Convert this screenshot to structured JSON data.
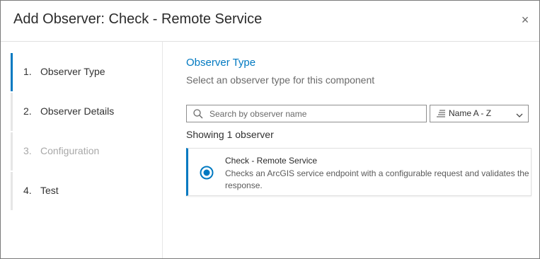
{
  "dialog": {
    "title": "Add Observer: Check - Remote Service",
    "close_glyph": "×"
  },
  "steps": [
    {
      "number": "1.",
      "label": "Observer Type",
      "state": "active"
    },
    {
      "number": "2.",
      "label": "Observer Details",
      "state": "enabled"
    },
    {
      "number": "3.",
      "label": "Configuration",
      "state": "disabled"
    },
    {
      "number": "4.",
      "label": "Test",
      "state": "enabled"
    }
  ],
  "main": {
    "section_title": "Observer Type",
    "section_subtitle": "Select an observer type for this component",
    "search": {
      "placeholder": "Search by observer name",
      "value": "",
      "icon": "search-icon"
    },
    "sort": {
      "selected": "Name A - Z",
      "icon": "sort-icon"
    },
    "result_count": "Showing 1 observer",
    "observers": [
      {
        "title": "Check - Remote Service",
        "description": "Checks an ArcGIS service endpoint with a configurable request and validates the response.",
        "selected": true
      }
    ]
  },
  "colors": {
    "accent": "#0079c1",
    "text": "#323232",
    "muted": "#6a6a6a",
    "disabled": "#a8a8a8",
    "border": "#e0e0e0"
  }
}
